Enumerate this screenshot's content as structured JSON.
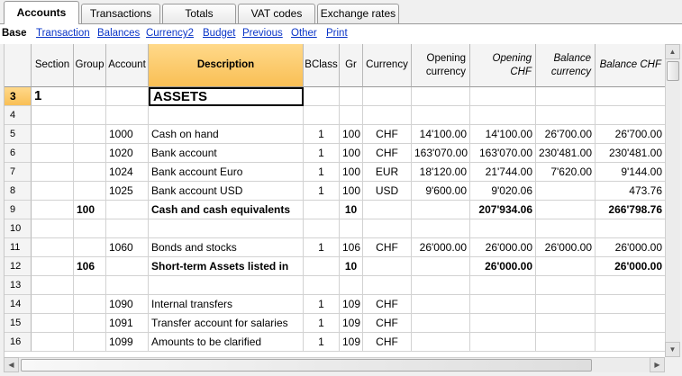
{
  "tabs": [
    {
      "label": "Accounts",
      "active": true
    },
    {
      "label": "Transactions",
      "active": false
    },
    {
      "label": "Totals",
      "active": false
    },
    {
      "label": "VAT codes",
      "active": false
    },
    {
      "label": "Exchange rates",
      "active": false
    }
  ],
  "views": {
    "base": "Base",
    "links": [
      "Transaction",
      "Balances",
      "Currency2",
      "Budget",
      "Previous",
      "Other",
      "Print"
    ]
  },
  "columns": [
    {
      "label": "",
      "key": "rownum"
    },
    {
      "label": "Section",
      "key": "section"
    },
    {
      "label": "Group",
      "key": "group"
    },
    {
      "label": "Account",
      "key": "account"
    },
    {
      "label": "Description",
      "key": "description",
      "selected": true
    },
    {
      "label": "BClass",
      "key": "bclass"
    },
    {
      "label": "Gr",
      "key": "gr"
    },
    {
      "label": "Currency",
      "key": "currency"
    },
    {
      "label": "Opening currency",
      "key": "opening_currency"
    },
    {
      "label": "Opening CHF",
      "key": "opening_chf",
      "italic": true
    },
    {
      "label": "Balance currency",
      "key": "balance_currency",
      "italic": true
    },
    {
      "label": "Balance CHF",
      "key": "balance_chf",
      "italic": true
    }
  ],
  "rows": [
    {
      "rownum": "3",
      "section": "1",
      "group": "",
      "account": "",
      "description": "ASSETS",
      "bclass": "",
      "gr": "",
      "currency": "",
      "opening_currency": "",
      "opening_chf": "",
      "balance_currency": "",
      "balance_chf": "",
      "style": "title"
    },
    {
      "rownum": "4",
      "section": "",
      "group": "",
      "account": "",
      "description": "",
      "bclass": "",
      "gr": "",
      "currency": "",
      "opening_currency": "",
      "opening_chf": "",
      "balance_currency": "",
      "balance_chf": ""
    },
    {
      "rownum": "5",
      "section": "",
      "group": "",
      "account": "1000",
      "description": "Cash on hand",
      "bclass": "1",
      "gr": "100",
      "currency": "CHF",
      "opening_currency": "14'100.00",
      "opening_chf": "14'100.00",
      "balance_currency": "26'700.00",
      "balance_chf": "26'700.00"
    },
    {
      "rownum": "6",
      "section": "",
      "group": "",
      "account": "1020",
      "description": "Bank account",
      "bclass": "1",
      "gr": "100",
      "currency": "CHF",
      "opening_currency": "163'070.00",
      "opening_chf": "163'070.00",
      "balance_currency": "230'481.00",
      "balance_chf": "230'481.00"
    },
    {
      "rownum": "7",
      "section": "",
      "group": "",
      "account": "1024",
      "description": "Bank account Euro",
      "bclass": "1",
      "gr": "100",
      "currency": "EUR",
      "opening_currency": "18'120.00",
      "opening_chf": "21'744.00",
      "balance_currency": "7'620.00",
      "balance_chf": "9'144.00"
    },
    {
      "rownum": "8",
      "section": "",
      "group": "",
      "account": "1025",
      "description": "Bank account USD",
      "bclass": "1",
      "gr": "100",
      "currency": "USD",
      "opening_currency": "9'600.00",
      "opening_chf": "9'020.06",
      "balance_currency": "",
      "balance_chf": "473.76"
    },
    {
      "rownum": "9",
      "section": "",
      "group": "100",
      "account": "",
      "description": "Cash and cash equivalents",
      "bclass": "",
      "gr": "10",
      "currency": "",
      "opening_currency": "",
      "opening_chf": "207'934.06",
      "balance_currency": "",
      "balance_chf": "266'798.76",
      "style": "bold"
    },
    {
      "rownum": "10",
      "section": "",
      "group": "",
      "account": "",
      "description": "",
      "bclass": "",
      "gr": "",
      "currency": "",
      "opening_currency": "",
      "opening_chf": "",
      "balance_currency": "",
      "balance_chf": ""
    },
    {
      "rownum": "11",
      "section": "",
      "group": "",
      "account": "1060",
      "description": "Bonds and stocks",
      "bclass": "1",
      "gr": "106",
      "currency": "CHF",
      "opening_currency": "26'000.00",
      "opening_chf": "26'000.00",
      "balance_currency": "26'000.00",
      "balance_chf": "26'000.00"
    },
    {
      "rownum": "12",
      "section": "",
      "group": "106",
      "account": "",
      "description": "Short-term Assets listed in",
      "bclass": "",
      "gr": "10",
      "currency": "",
      "opening_currency": "",
      "opening_chf": "26'000.00",
      "balance_currency": "",
      "balance_chf": "26'000.00",
      "style": "bold"
    },
    {
      "rownum": "13",
      "section": "",
      "group": "",
      "account": "",
      "description": "",
      "bclass": "",
      "gr": "",
      "currency": "",
      "opening_currency": "",
      "opening_chf": "",
      "balance_currency": "",
      "balance_chf": ""
    },
    {
      "rownum": "14",
      "section": "",
      "group": "",
      "account": "1090",
      "description": "Internal transfers",
      "bclass": "1",
      "gr": "109",
      "currency": "CHF",
      "opening_currency": "",
      "opening_chf": "",
      "balance_currency": "",
      "balance_chf": ""
    },
    {
      "rownum": "15",
      "section": "",
      "group": "",
      "account": "1091",
      "description": "Transfer account for salaries",
      "bclass": "1",
      "gr": "109",
      "currency": "CHF",
      "opening_currency": "",
      "opening_chf": "",
      "balance_currency": "",
      "balance_chf": ""
    },
    {
      "rownum": "16",
      "section": "",
      "group": "",
      "account": "1099",
      "description": "Amounts to be clarified",
      "bclass": "1",
      "gr": "109",
      "currency": "CHF",
      "opening_currency": "",
      "opening_chf": "",
      "balance_currency": "",
      "balance_chf": ""
    }
  ],
  "colors": {
    "link": "#0a35c8",
    "selected_header": "#f9bf55",
    "grid_line": "#d2d2d2"
  }
}
